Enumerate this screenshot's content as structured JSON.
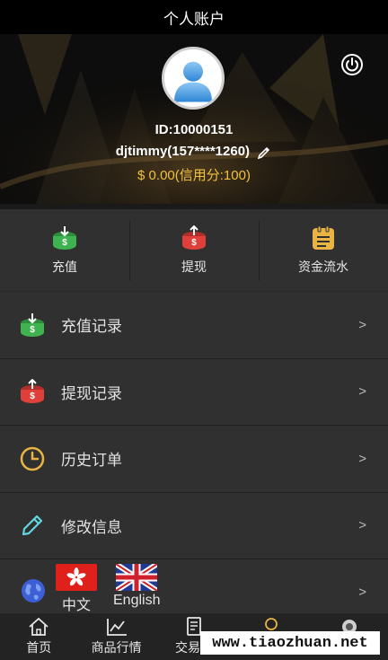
{
  "header": {
    "title": "个人账户"
  },
  "profile": {
    "id_text": "ID:10000151",
    "username": "djtimmy(157****1260)",
    "balance": "$ 0.00(信用分:100)"
  },
  "quick_actions": [
    {
      "label": "充值",
      "icon": "deposit-icon",
      "color": "#3fb34f"
    },
    {
      "label": "提现",
      "icon": "withdraw-icon",
      "color": "#e0403a"
    },
    {
      "label": "资金流水",
      "icon": "ledger-icon",
      "color": "#e9b443"
    }
  ],
  "menu": [
    {
      "label": "充值记录",
      "icon": "deposit-icon",
      "chevron": ">"
    },
    {
      "label": "提现记录",
      "icon": "withdraw-icon",
      "chevron": ">"
    },
    {
      "label": "历史订单",
      "icon": "clock-icon",
      "chevron": ">"
    },
    {
      "label": "修改信息",
      "icon": "pencil-icon",
      "chevron": ">"
    }
  ],
  "language": {
    "options": [
      {
        "label": "中文",
        "icon": "hong-kong-flag-icon"
      },
      {
        "label": "English",
        "icon": "uk-flag-icon"
      }
    ],
    "chevron": ">"
  },
  "tabbar": [
    {
      "label": "首页",
      "icon": "home-icon"
    },
    {
      "label": "商品行情",
      "icon": "chart-icon"
    },
    {
      "label": "交易记",
      "icon": "document-icon"
    },
    {
      "label": "",
      "icon": "user-icon"
    },
    {
      "label": "",
      "icon": "service-icon"
    }
  ],
  "watermark": "www.tiaozhuan.net",
  "colors": {
    "accent_gold": "#f0c040",
    "green": "#3fb34f",
    "red": "#e0403a",
    "blue_globe": "#3d5fd6"
  }
}
